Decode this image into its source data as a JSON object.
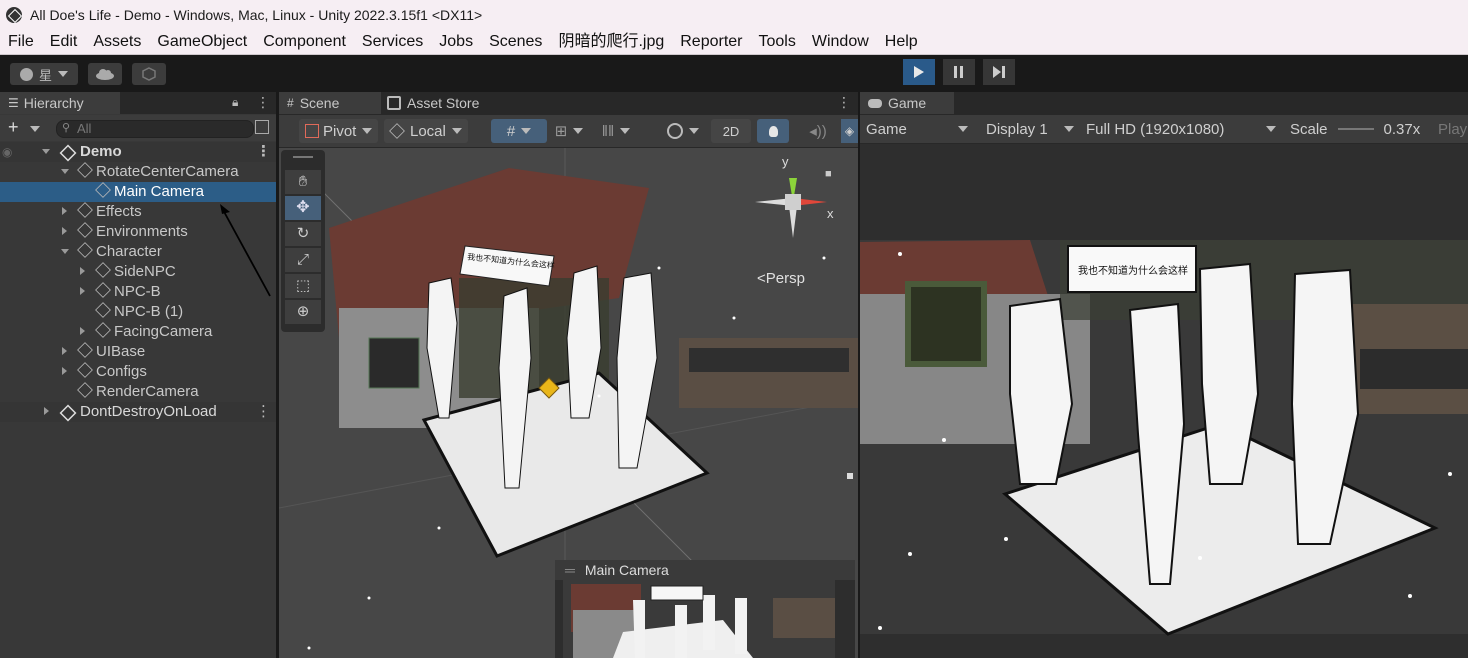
{
  "window": {
    "title": "All Doe's Life - Demo - Windows, Mac, Linux - Unity 2022.3.15f1 <DX11>"
  },
  "menu": [
    "File",
    "Edit",
    "Assets",
    "GameObject",
    "Component",
    "Services",
    "Jobs",
    "Scenes",
    "阴暗的爬行.jpg",
    "Reporter",
    "Tools",
    "Window",
    "Help"
  ],
  "toolbar": {
    "account_label": "星"
  },
  "hierarchy": {
    "tab": "Hierarchy",
    "search_placeholder": "All",
    "items": [
      {
        "label": "Demo",
        "depth": 0
      },
      {
        "label": "RotateCenterCamera",
        "depth": 1
      },
      {
        "label": "Main Camera",
        "depth": 2
      },
      {
        "label": "Effects",
        "depth": 1
      },
      {
        "label": "Environments",
        "depth": 1
      },
      {
        "label": "Character",
        "depth": 1
      },
      {
        "label": "SideNPC",
        "depth": 2
      },
      {
        "label": "NPC-B",
        "depth": 2
      },
      {
        "label": "NPC-B (1)",
        "depth": 2
      },
      {
        "label": "FacingCamera",
        "depth": 2
      },
      {
        "label": "UIBase",
        "depth": 1
      },
      {
        "label": "Configs",
        "depth": 1
      },
      {
        "label": "RenderCamera",
        "depth": 1
      },
      {
        "label": "DontDestroyOnLoad",
        "depth": 0
      }
    ]
  },
  "scene": {
    "tabs": [
      "Scene",
      "Asset Store"
    ],
    "pivot": "Pivot",
    "local": "Local",
    "mode_2d": "2D",
    "persp": "<Persp",
    "axis_x": "x",
    "axis_y": "y",
    "speech": "我也不知道为什么会这样",
    "overlay_title": "Main Camera"
  },
  "game": {
    "tab": "Game",
    "view": "Game",
    "display": "Display 1",
    "resolution": "Full HD (1920x1080)",
    "scale_label": "Scale",
    "scale_value": "0.37x",
    "play_label": "Play",
    "speech": "我也不知道为什么会这样"
  }
}
